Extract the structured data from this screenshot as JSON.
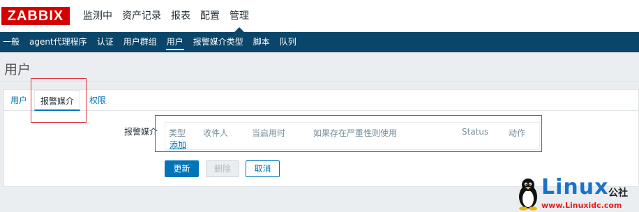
{
  "brand": {
    "logo_text": "ZABBIX"
  },
  "main_menu": [
    {
      "label": "监测中"
    },
    {
      "label": "资产记录"
    },
    {
      "label": "报表"
    },
    {
      "label": "配置"
    },
    {
      "label": "管理"
    }
  ],
  "sub_menu": [
    {
      "label": "一般"
    },
    {
      "label": "agent代理程序"
    },
    {
      "label": "认证"
    },
    {
      "label": "用户群组"
    },
    {
      "label": "用户"
    },
    {
      "label": "报警媒介类型"
    },
    {
      "label": "脚本"
    },
    {
      "label": "队列"
    }
  ],
  "page": {
    "title": "用户"
  },
  "tabs": [
    {
      "label": "用户"
    },
    {
      "label": "报警媒介"
    },
    {
      "label": "权限"
    }
  ],
  "media": {
    "field_label": "报警媒介",
    "columns": [
      "类型",
      "收件人",
      "当启用时",
      "如果存在严重性则使用",
      "Status",
      "动作"
    ],
    "add_link": "添加"
  },
  "buttons": {
    "update": "更新",
    "delete": "删除",
    "cancel": "取消"
  },
  "watermark": {
    "linux": "Linux",
    "gongshe": "公社",
    "url": "www.Linuxidc.com"
  },
  "colors": {
    "logo_bg": "#d40000",
    "subnav_bg": "#0a466a",
    "link": "#0275b8",
    "annotation": "#e0303a"
  }
}
